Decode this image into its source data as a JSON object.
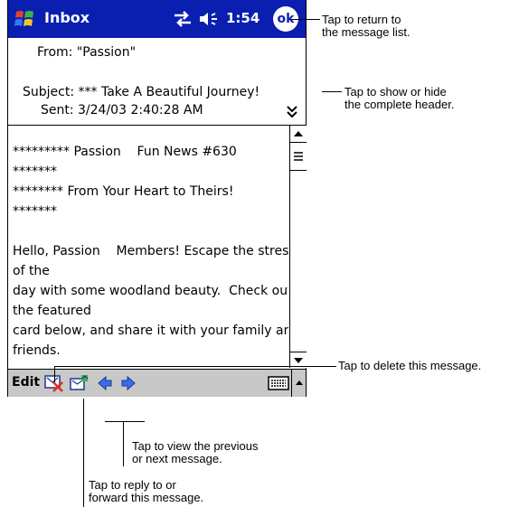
{
  "titlebar": {
    "app_title": "Inbox",
    "clock": "1:54",
    "ok_label": "ok"
  },
  "header": {
    "from": "From: \"Passion\"",
    "subject": "Subject: *** Take A Beautiful Journey!",
    "sent": "Sent: 3/24/03 2:40:28 AM"
  },
  "body": {
    "lines": [
      "********* Passion    Fun News #630",
      "*******",
      "******** From Your Heart to Theirs!",
      "*******",
      "",
      "Hello, Passion    Members! Escape the stress",
      "of the",
      "day with some woodland beauty.  Check out",
      "the featured",
      "card below, and share it with your family and",
      "friends."
    ]
  },
  "toolbar": {
    "edit_label": "Edit"
  },
  "callouts": {
    "ok_line1": "Tap to return to",
    "ok_line2": "the message list.",
    "header_line1": "Tap to show or hide",
    "header_line2": "the complete header.",
    "delete": "Tap to delete this message.",
    "nav_line1": "Tap to view the previous",
    "nav_line2": "or next message.",
    "reply_line1": "Tap to reply to or",
    "reply_line2": "forward this message."
  }
}
